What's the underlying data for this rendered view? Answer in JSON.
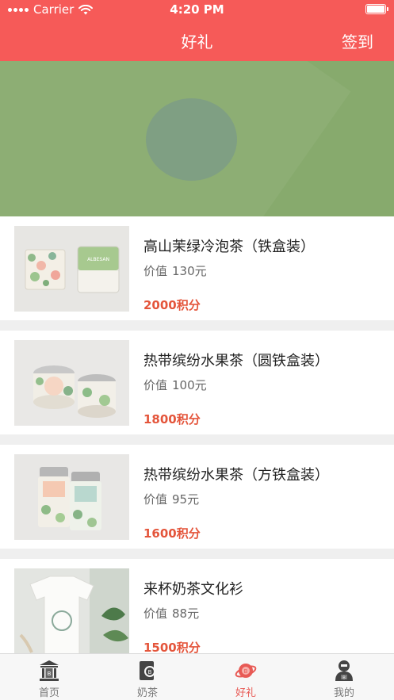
{
  "status_bar": {
    "carrier": "Carrier",
    "time": "4:20 PM"
  },
  "nav": {
    "title": "好礼",
    "right_action": "签到"
  },
  "gifts": [
    {
      "name": "高山茉绿冷泡茶（铁盒装）",
      "value_prefix": "价值",
      "value": "130元",
      "points": "2000积分",
      "image": "tea-box-square-white"
    },
    {
      "name": "热带缤纷水果茶（圆铁盒装）",
      "value_prefix": "价值",
      "value": "100元",
      "points": "1800积分",
      "image": "round-tin-cans"
    },
    {
      "name": "热带缤纷水果茶（方铁盒装）",
      "value_prefix": "价值",
      "value": "95元",
      "points": "1600积分",
      "image": "square-tin-cans"
    },
    {
      "name": "来杯奶茶文化衫",
      "value_prefix": "价值",
      "value": "88元",
      "points": "1500积分",
      "image": "culture-tshirt"
    }
  ],
  "tabbar": {
    "items": [
      {
        "label": "首页",
        "icon": "bank-icon",
        "active": false
      },
      {
        "label": "奶茶",
        "icon": "wallet-icon",
        "active": false
      },
      {
        "label": "好礼",
        "icon": "gift-planet-icon",
        "active": true
      },
      {
        "label": "我的",
        "icon": "user-icon",
        "active": false
      }
    ]
  },
  "colors": {
    "accent": "#f65a58",
    "points": "#e4553b",
    "banner": "#87aa6d"
  }
}
